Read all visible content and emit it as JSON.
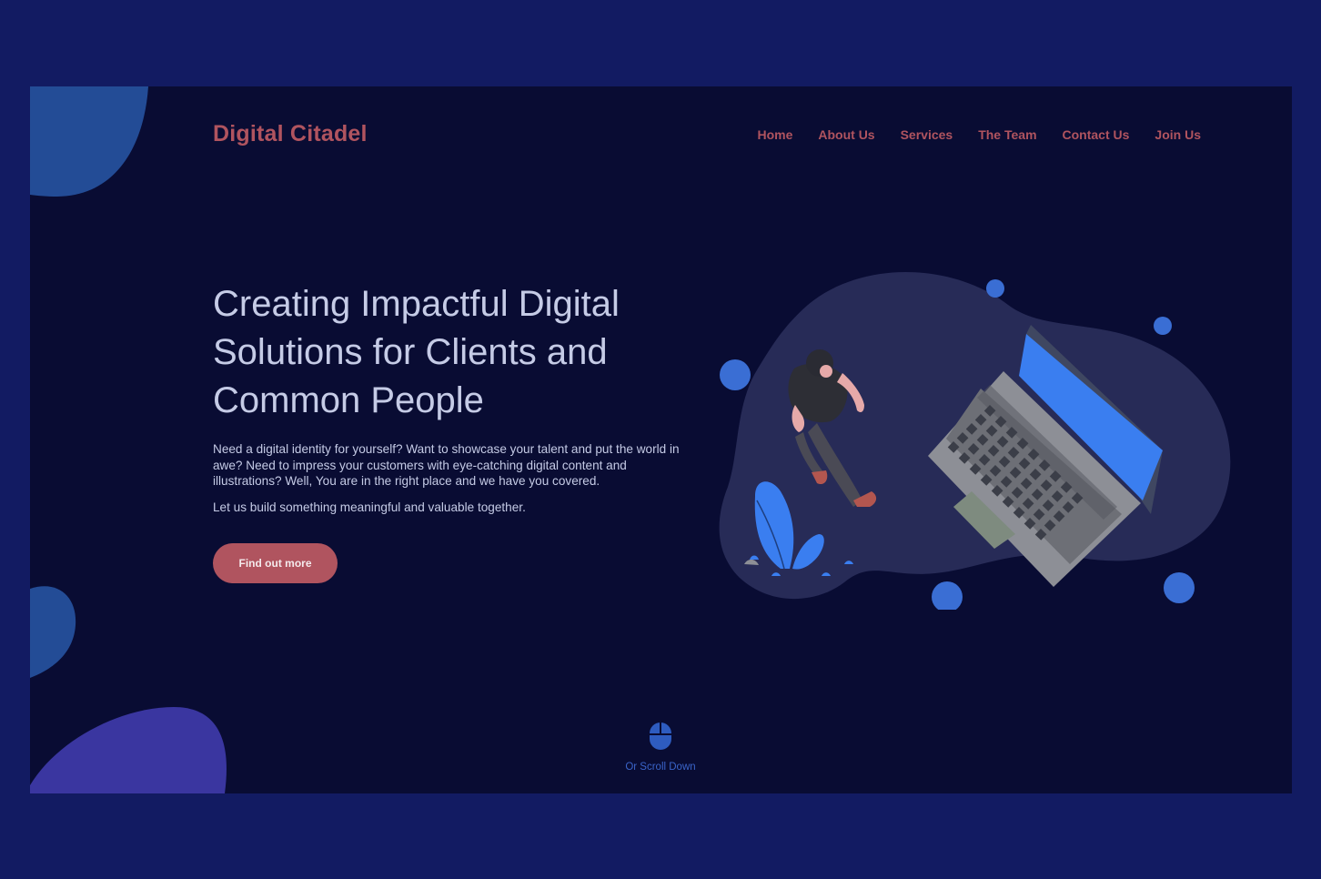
{
  "brand": "Digital Citadel",
  "nav": {
    "items": [
      "Home",
      "About Us",
      "Services",
      "The Team",
      "Contact Us",
      "Join Us"
    ]
  },
  "hero": {
    "headline": "Creating Impactful Digital Solutions for Clients and Common People",
    "description": "Need a digital identity for yourself? Want to showcase your talent and put the world in awe? Need to impress your customers with eye-catching digital content and illustrations? Well, You are in the right place and we have you covered.",
    "tagline": "Let us build something meaningful and valuable together.",
    "cta_label": "Find out more"
  },
  "scroll": {
    "label": "Or Scroll Down",
    "icon": "mouse-icon"
  },
  "illustration": {
    "name": "person-with-laptop-illustration"
  },
  "colors": {
    "page_bg": "#121b62",
    "frame_bg": "#090c33",
    "accent": "#b0545f",
    "text": "#c5cbe6",
    "blue": "#3a6ed4"
  }
}
